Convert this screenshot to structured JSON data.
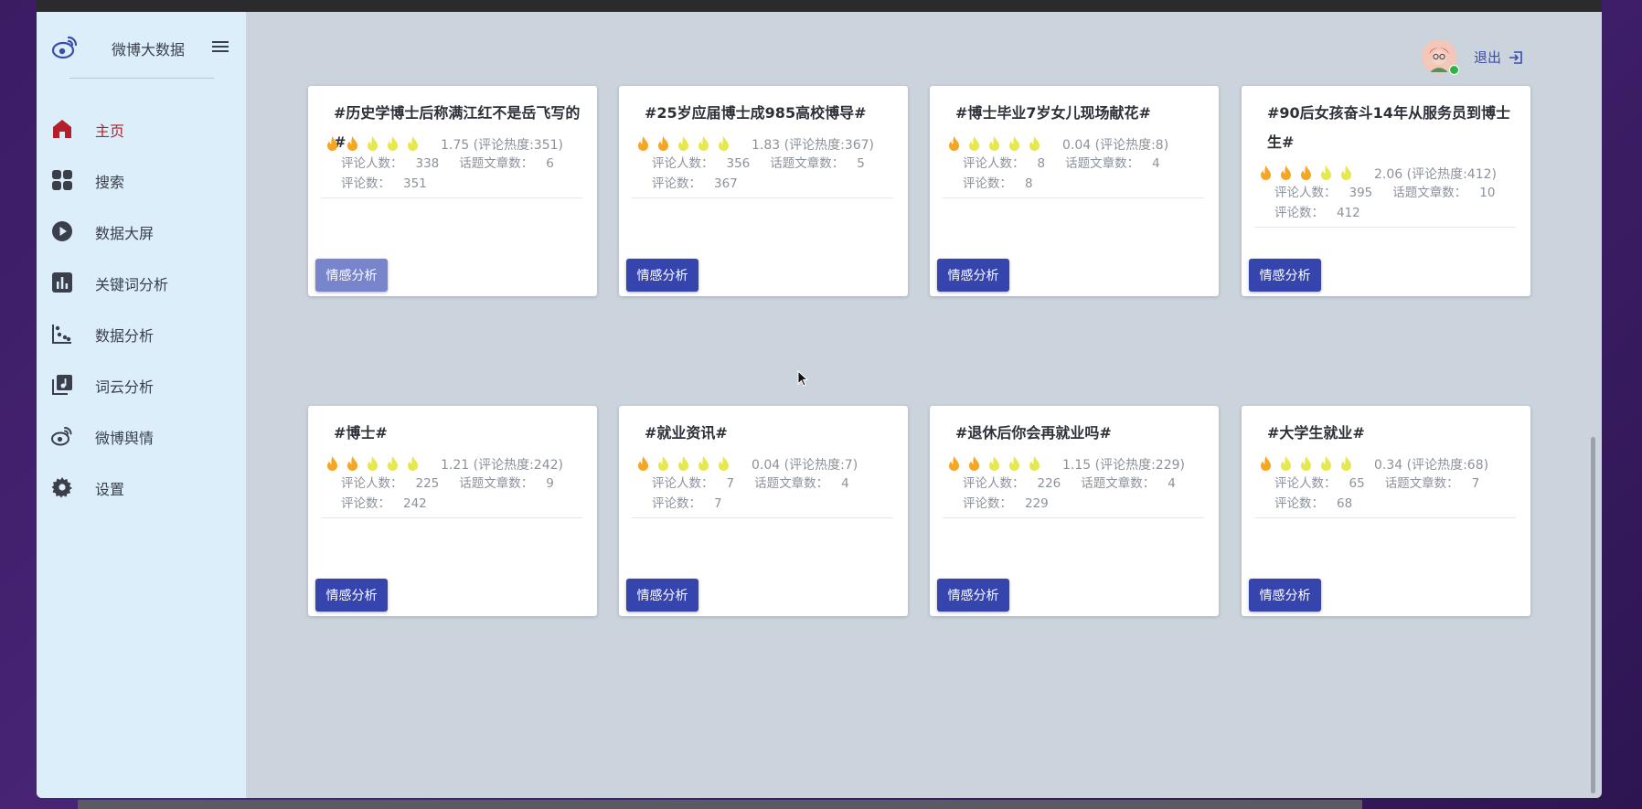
{
  "app": {
    "brand": "微博大数据",
    "logout_label": "退出"
  },
  "sidebar": {
    "items": [
      {
        "label": "主页",
        "icon": "home-icon",
        "active": true
      },
      {
        "label": "搜索",
        "icon": "grid-icon",
        "active": false
      },
      {
        "label": "数据大屏",
        "icon": "play-circle-icon",
        "active": false
      },
      {
        "label": "关键词分析",
        "icon": "bar-chart-icon",
        "active": false
      },
      {
        "label": "数据分析",
        "icon": "scatter-chart-icon",
        "active": false
      },
      {
        "label": "词云分析",
        "icon": "music-library-icon",
        "active": false
      },
      {
        "label": "微博舆情",
        "icon": "weibo-icon",
        "active": false
      },
      {
        "label": "设置",
        "icon": "gear-icon",
        "active": false
      }
    ]
  },
  "labels": {
    "commenters": "评论人数：",
    "articles": "话题文章数：",
    "comments": "评论数："
  },
  "cards": [
    {
      "title": "#历史学博士后称满江红不是岳飞写的#",
      "score": "1.75",
      "heat_text": "(评论热度:351)",
      "commenters": "338",
      "articles": "6",
      "comments": "351",
      "hot_flames": 2,
      "button": "情感分析"
    },
    {
      "title": "#25岁应届博士成985高校博导#",
      "score": "1.83",
      "heat_text": "(评论热度:367)",
      "commenters": "356",
      "articles": "5",
      "comments": "367",
      "hot_flames": 2,
      "button": "情感分析"
    },
    {
      "title": "#博士毕业7岁女儿现场献花#",
      "score": "0.04",
      "heat_text": "(评论热度:8)",
      "commenters": "8",
      "articles": "4",
      "comments": "8",
      "hot_flames": 1,
      "button": "情感分析"
    },
    {
      "title": "#90后女孩奋斗14年从服务员到博士生#",
      "score": "2.06",
      "heat_text": "(评论热度:412)",
      "commenters": "395",
      "articles": "10",
      "comments": "412",
      "hot_flames": 3,
      "button": "情感分析"
    },
    {
      "title": "#博士#",
      "score": "1.21",
      "heat_text": "(评论热度:242)",
      "commenters": "225",
      "articles": "9",
      "comments": "242",
      "hot_flames": 2,
      "button": "情感分析"
    },
    {
      "title": "#就业资讯#",
      "score": "0.04",
      "heat_text": "(评论热度:7)",
      "commenters": "7",
      "articles": "4",
      "comments": "7",
      "hot_flames": 1,
      "button": "情感分析"
    },
    {
      "title": "#退休后你会再就业吗#",
      "score": "1.15",
      "heat_text": "(评论热度:229)",
      "commenters": "226",
      "articles": "4",
      "comments": "229",
      "hot_flames": 2,
      "button": "情感分析"
    },
    {
      "title": "#大学生就业#",
      "score": "0.34",
      "heat_text": "(评论热度:68)",
      "commenters": "65",
      "articles": "7",
      "comments": "68",
      "hot_flames": 1,
      "button": "情感分析"
    }
  ],
  "colors": {
    "flame_hot": "#f5a623",
    "flame_cold": "#e6e84f",
    "button": "#3545ad",
    "active_nav": "#b3202a"
  }
}
